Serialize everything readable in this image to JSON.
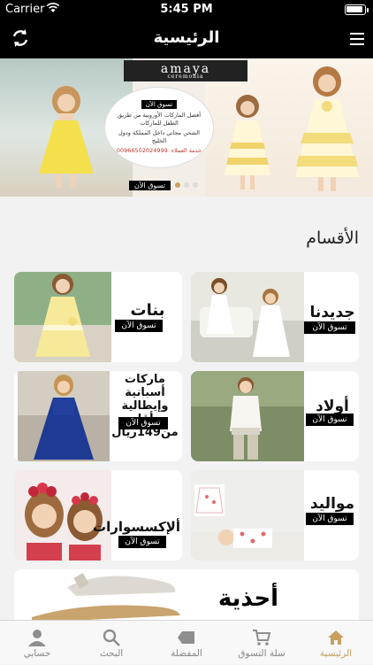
{
  "status_bar": {
    "carrier": "Carrier",
    "time": "5:45 PM"
  },
  "navbar": {
    "title": "الرئيسية",
    "refresh_icon": "refresh-icon",
    "menu_icon": "hamburger-menu-icon"
  },
  "banner": {
    "brand": "amaya",
    "brand_sub": "ceremonia",
    "shop_now": "تسوق الآن",
    "promo_line1": "أفضل الماركات الأوروبية من طريق الطفل للماركات",
    "promo_line2": "الشحن مجاني داخل المملكة ودول الخليج",
    "promo_phone": "خدمة العملاء: 00966502024999",
    "page_count": 3,
    "active_page": 1
  },
  "section": {
    "title": "الأقسام"
  },
  "categories": [
    {
      "name": "جديدنا",
      "shop": "تسوق الآن"
    },
    {
      "name": "بنات",
      "shop": "تسوق الآن"
    },
    {
      "name": "أولاد",
      "shop": "تسوق الآن"
    },
    {
      "name_line1": "ماركات",
      "name_line2": "أسبانية وإيطالية",
      "name_line3": "بأقل من149ريال",
      "shop": "تسوق الآن"
    },
    {
      "name": "مواليد",
      "shop": "تسوق الآن"
    },
    {
      "name": "ألإكسسوارات",
      "shop": "تسوق الآن"
    },
    {
      "name": "أحذية"
    }
  ],
  "tabbar": {
    "items": [
      {
        "label": "الرئيسية",
        "icon": "home-icon",
        "active": true
      },
      {
        "label": "سلة التسوق",
        "icon": "cart-icon",
        "active": false
      },
      {
        "label": "المفضلة",
        "icon": "tag-icon",
        "active": false
      },
      {
        "label": "البحث",
        "icon": "search-icon",
        "active": false
      },
      {
        "label": "حسابي",
        "icon": "user-icon",
        "active": false
      }
    ]
  },
  "colors": {
    "accent": "#c8a060",
    "bar": "#000000"
  }
}
